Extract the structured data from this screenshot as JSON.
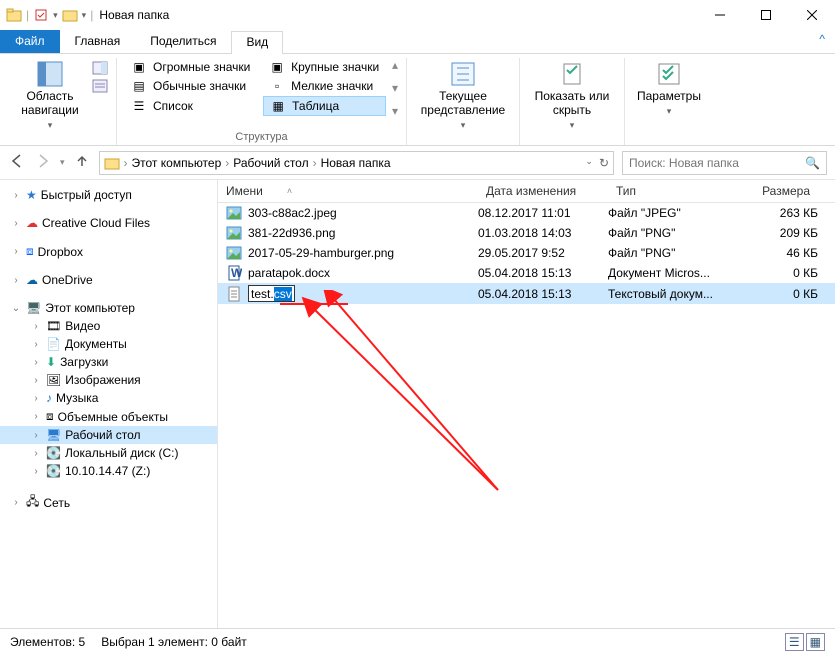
{
  "window": {
    "title": "Новая папка"
  },
  "tabs": {
    "file": "Файл",
    "home": "Главная",
    "share": "Поделиться",
    "view": "Вид"
  },
  "ribbon": {
    "navpane": "Область навигации",
    "group_panes": "",
    "sizes": {
      "huge": "Огромные значки",
      "large": "Крупные значки",
      "normal": "Обычные значки",
      "small": "Мелкие значки",
      "list": "Список",
      "table": "Таблица"
    },
    "group_structure": "Структура",
    "current_view": "Текущее представление",
    "show_hide": "Показать или скрыть",
    "options": "Параметры"
  },
  "breadcrumb": {
    "pc": "Этот компьютер",
    "desktop": "Рабочий стол",
    "folder": "Новая папка"
  },
  "search": {
    "placeholder": "Поиск: Новая папка"
  },
  "columns": {
    "name": "Имени",
    "date": "Дата изменения",
    "type": "Тип",
    "size": "Размера"
  },
  "sidebar": {
    "quick": "Быстрый доступ",
    "ccf": "Creative Cloud Files",
    "dropbox": "Dropbox",
    "onedrive": "OneDrive",
    "pc": "Этот компьютер",
    "pc_items": {
      "video": "Видео",
      "docs": "Документы",
      "downloads": "Загрузки",
      "pics": "Изображения",
      "music": "Музыка",
      "objs": "Объемные объекты",
      "desktop": "Рабочий стол",
      "cdisk": "Локальный диск (C:)",
      "zdisk": "10.10.14.47 (Z:)"
    },
    "net": "Сеть"
  },
  "files": [
    {
      "name": "303-c88ac2.jpeg",
      "date": "08.12.2017 11:01",
      "type": "Файл \"JPEG\"",
      "size": "263 КБ",
      "icon": "img"
    },
    {
      "name": "381-22d936.png",
      "date": "01.03.2018 14:03",
      "type": "Файл \"PNG\"",
      "size": "209 КБ",
      "icon": "img"
    },
    {
      "name": "2017-05-29-hamburger.png",
      "date": "29.05.2017 9:52",
      "type": "Файл \"PNG\"",
      "size": "46 КБ",
      "icon": "img"
    },
    {
      "name": "paratapok.docx",
      "date": "05.04.2018 15:13",
      "type": "Документ Micros...",
      "size": "0 КБ",
      "icon": "doc"
    },
    {
      "name_base": "test.",
      "name_sel": "csv",
      "date": "05.04.2018 15:13",
      "type": "Текстовый докум...",
      "size": "0 КБ",
      "icon": "txt",
      "editing": true
    }
  ],
  "footer": {
    "count": "Элементов: 5",
    "sel": "Выбран 1 элемент: 0 байт"
  }
}
